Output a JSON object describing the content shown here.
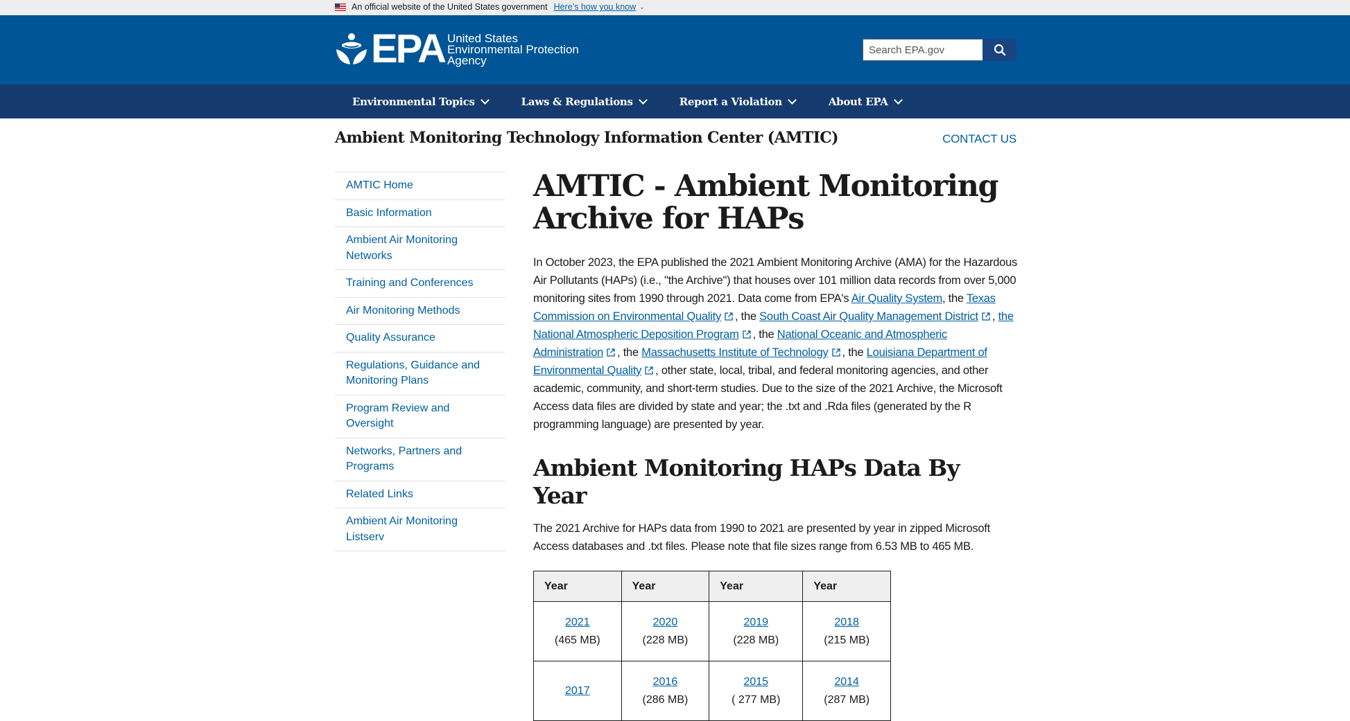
{
  "gov_banner": {
    "text": "An official website of the United States government",
    "link": "Here’s how you know"
  },
  "header": {
    "logo_abbr": "EPA",
    "agency_line1": "United States",
    "agency_line2": "Environmental Protection",
    "agency_line3": "Agency",
    "search_placeholder": "Search EPA.gov"
  },
  "nav": {
    "items": [
      {
        "label": "Environmental Topics"
      },
      {
        "label": "Laws & Regulations"
      },
      {
        "label": "Report a Violation"
      },
      {
        "label": "About EPA"
      }
    ]
  },
  "microsite": {
    "title": "Ambient Monitoring Technology Information Center (AMTIC)",
    "contact": "CONTACT US"
  },
  "sidebar": {
    "items": [
      {
        "label": "AMTIC Home"
      },
      {
        "label": "Basic Information"
      },
      {
        "label": "Ambient Air Monitoring Networks"
      },
      {
        "label": "Training and Conferences"
      },
      {
        "label": "Air Monitoring Methods"
      },
      {
        "label": "Quality Assurance"
      },
      {
        "label": "Regulations, Guidance and Monitoring Plans"
      },
      {
        "label": "Program Review and Oversight"
      },
      {
        "label": "Networks, Partners and Programs"
      },
      {
        "label": "Related Links"
      },
      {
        "label": "Ambient Air Monitoring Listserv"
      }
    ]
  },
  "main": {
    "title": "AMTIC - Ambient Monitoring Archive for HAPs",
    "intro": {
      "t1": "In October 2023, the EPA published the 2021 Ambient Monitoring Archive (AMA) for the Hazardous Air Pollutants (HAPs) (i.e., \"the Archive\") that houses over 101 million data records from over 5,000 monitoring sites from 1990 through 2021. Data come from EPA's ",
      "l1": "Air Quality System",
      "t2": ", the ",
      "l2": "Texas Commission on Environmental Quality",
      "t3": ", the ",
      "l3": "South Coast Air Quality Management District",
      "t4": ", ",
      "l4": "the National Atmospheric Deposition Program",
      "t5": ", the ",
      "l5": "National Oceanic and Atmospheric Administration",
      "t6": ", the ",
      "l6": "Massachusetts Institute of Technology",
      "t7": ", the ",
      "l7": "Louisiana Department of Environmental Quality",
      "t8": ", other state, local, tribal, and federal monitoring agencies, and other academic, community, and short-term studies. Due to the size of the 2021 Archive, the Microsoft Access data files are divided by state and year; the .txt and .Rda files (generated by the R programming language) are presented by year."
    },
    "section_title": "Ambient Monitoring HAPs Data By Year",
    "section_text": "The 2021 Archive for HAPs data from 1990 to 2021 are presented by year in zipped Microsoft Access databases and .txt files. Please note that file sizes range from 6.53 MB to 465 MB.",
    "table": {
      "headers": [
        "Year",
        "Year",
        "Year",
        "Year"
      ],
      "rows": [
        [
          {
            "year": "2021",
            "size": "(465 MB)"
          },
          {
            "year": "2020",
            "size": "(228 MB)"
          },
          {
            "year": "2019",
            "size": "(228 MB)"
          },
          {
            "year": "2018",
            "size": "(215 MB)"
          }
        ],
        [
          {
            "year": "2017",
            "size": ""
          },
          {
            "year": "2016",
            "size": "(286 MB)"
          },
          {
            "year": "2015",
            "size": "( 277 MB)"
          },
          {
            "year": "2014",
            "size": "(287 MB)"
          }
        ]
      ]
    }
  }
}
